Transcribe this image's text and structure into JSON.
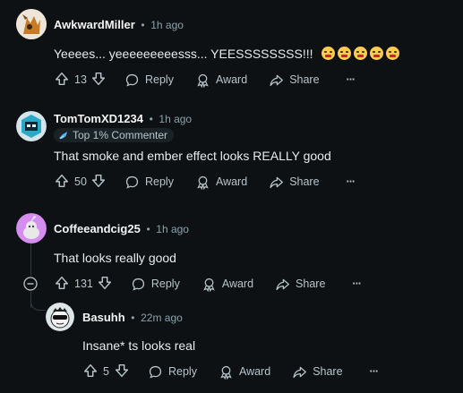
{
  "comments": [
    {
      "author": "AwkwardMiller",
      "time": "1h ago",
      "text": "Yeeees... yeeeeeeeeesss... YEESSSSSSSS!!!",
      "emoji_count": 5,
      "votes": "13",
      "actions": {
        "reply": "Reply",
        "award": "Award",
        "share": "Share"
      }
    },
    {
      "author": "TomTomXD1234",
      "time": "1h ago",
      "badge": "Top 1% Commenter",
      "text": "That smoke and ember effect looks REALLY good",
      "votes": "50",
      "actions": {
        "reply": "Reply",
        "award": "Award",
        "share": "Share"
      }
    },
    {
      "author": "Coffeeandcig25",
      "time": "1h ago",
      "text": "That looks really good",
      "votes": "131",
      "actions": {
        "reply": "Reply",
        "award": "Award",
        "share": "Share"
      }
    },
    {
      "author": "Basuhh",
      "time": "22m ago",
      "text": "Insane* ts looks real",
      "votes": "5",
      "actions": {
        "reply": "Reply",
        "award": "Award",
        "share": "Share"
      }
    }
  ],
  "separator": "•",
  "more": "···",
  "colors": {
    "background": "#0e1113",
    "text": "#d7dadc",
    "meta": "#8ba2ad",
    "badge_bg": "#1a2226"
  }
}
